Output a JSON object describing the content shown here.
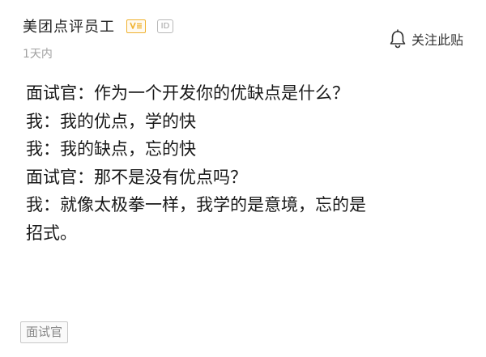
{
  "post": {
    "author": "美团点评员工",
    "badges": {
      "verified_icon": "v-badge-icon",
      "id_label": "ID"
    },
    "time": "1天内",
    "follow_label": "关注此贴",
    "follow_icon": "bell-icon",
    "lines": [
      "面试官：作为一个开发你的优缺点是什么？",
      "我：我的优点，学的快",
      "我：我的缺点，忘的快",
      "面试官：那不是没有优点吗？",
      "我：就像太极拳一样，我学的是意境，忘的是",
      "招式。"
    ],
    "tag": "面试官"
  },
  "colors": {
    "verified_badge": "#f0b230",
    "muted_text": "#a0a0a0",
    "body_text": "#1a1a1a"
  }
}
